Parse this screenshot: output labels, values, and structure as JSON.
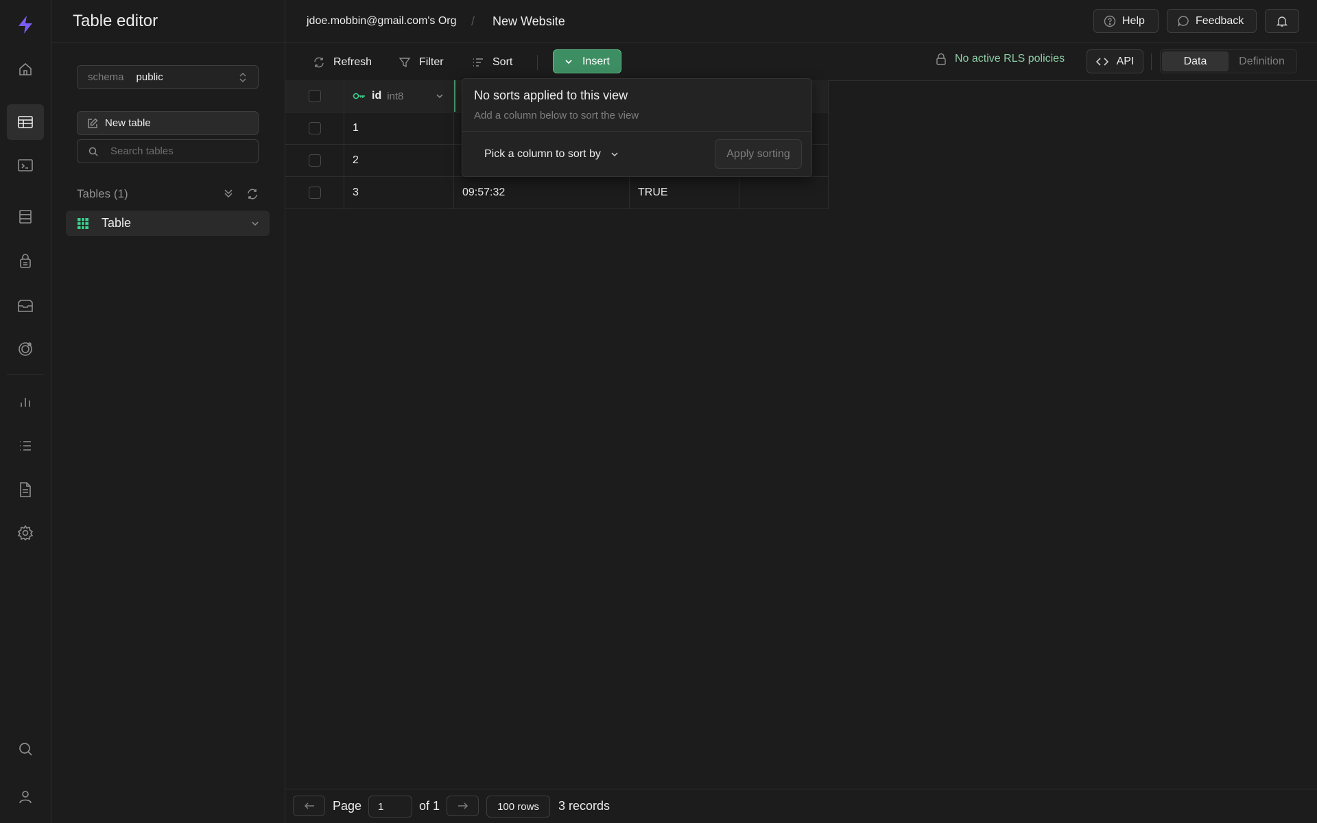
{
  "app": {
    "page_title": "Table editor",
    "logo_icon": "supabase-logo-icon",
    "accent_color": "#3ecf8e"
  },
  "breadcrumb": {
    "org": "jdoe.mobbin@gmail.com's Org",
    "separator": "/",
    "project": "New Website"
  },
  "header": {
    "help_label": "Help",
    "feedback_label": "Feedback"
  },
  "rail": {
    "items": [
      "home-icon",
      "table-editor-icon",
      "sql-editor-icon",
      "database-icon",
      "authentication-icon",
      "storage-icon",
      "edge-functions-icon",
      "reports-icon",
      "logs-icon",
      "api-docs-icon",
      "settings-icon",
      "search-icon",
      "user-icon"
    ]
  },
  "sidebar": {
    "schema_label": "schema",
    "schema_value": "public",
    "new_table_label": "New table",
    "search_placeholder": "Search tables",
    "tables_header": "Tables (1)",
    "tables": [
      {
        "name": "Table"
      }
    ]
  },
  "toolbar": {
    "refresh_label": "Refresh",
    "filter_label": "Filter",
    "sort_label": "Sort",
    "insert_label": "Insert",
    "rls_label": "No active RLS policies",
    "api_label": "API",
    "view_tabs": [
      "Data",
      "Definition"
    ],
    "active_view": "Data"
  },
  "grid": {
    "columns": [
      {
        "name": "id",
        "type": "int8"
      }
    ],
    "rows": [
      {
        "id": "1",
        "c2": "",
        "c3": "",
        "c4": ""
      },
      {
        "id": "2",
        "c2": "",
        "c3": "",
        "c4": ""
      },
      {
        "id": "3",
        "c2": "09:57:32",
        "c3": "TRUE",
        "c4": ""
      }
    ]
  },
  "sort_popover": {
    "title": "No sorts applied to this view",
    "subtitle": "Add a column below to sort the view",
    "pick_label": "Pick a column to sort by",
    "apply_label": "Apply sorting"
  },
  "footer": {
    "page_label": "Page",
    "page_value": "1",
    "of_label": "of 1",
    "rows_label": "100 rows",
    "records_label": "3 records"
  }
}
